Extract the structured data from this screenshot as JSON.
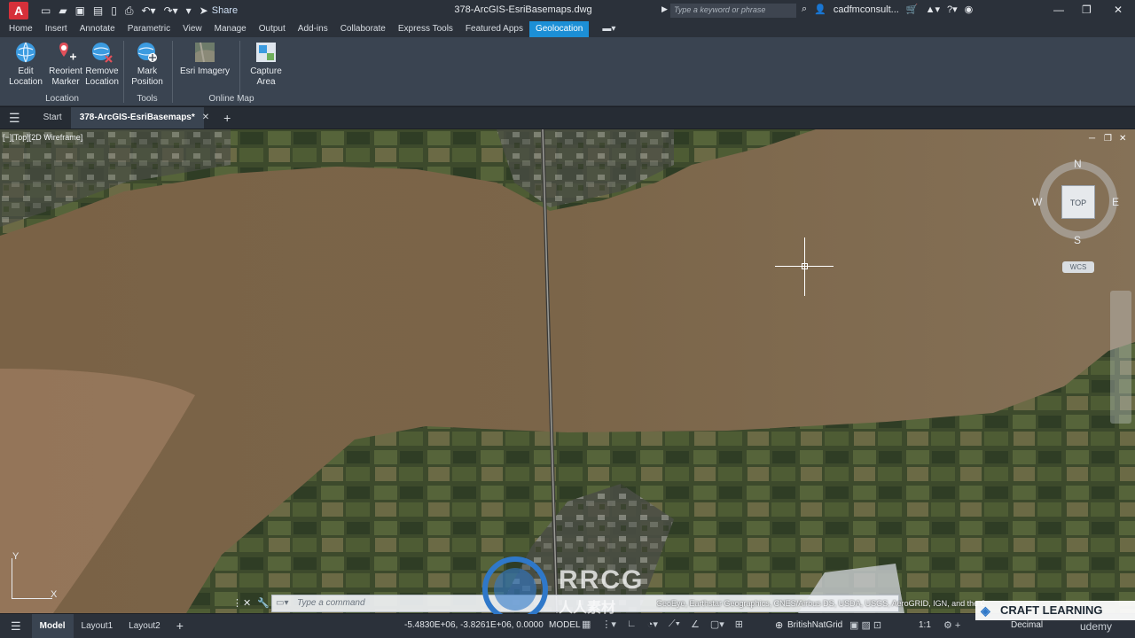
{
  "title_bar": {
    "app_letter": "A",
    "share_label": "Share",
    "document_title": "378-ArcGIS-EsriBasemaps.dwg",
    "search_placeholder": "Type a keyword or phrase",
    "user_name": "cadfmconsult..."
  },
  "ribbon": {
    "tabs": [
      "Home",
      "Insert",
      "Annotate",
      "Parametric",
      "View",
      "Manage",
      "Output",
      "Add-ins",
      "Collaborate",
      "Express Tools",
      "Featured Apps",
      "Geolocation"
    ],
    "active_tab": "Geolocation",
    "buttons": {
      "edit_location": "Edit\nLocation",
      "reorient_marker": "Reorient\nMarker",
      "remove_location": "Remove\nLocation",
      "mark_position": "Mark\nPosition",
      "esri_imagery": "Esri Imagery",
      "capture_area": "Capture\nArea"
    },
    "groups": {
      "location": "Location",
      "tools": "Tools",
      "online_map": "Online Map"
    }
  },
  "doc_tabs": {
    "start": "Start",
    "active": "378-ArcGIS-EsriBasemaps*"
  },
  "viewport": {
    "label": "[−][Top][2D Wireframe]",
    "viewcube": {
      "top": "TOP",
      "n": "N",
      "s": "S",
      "e": "E",
      "w": "W",
      "wcs": "WCS"
    },
    "ucs": {
      "x": "X",
      "y": "Y"
    }
  },
  "command_line": {
    "placeholder": "Type a command",
    "map_credits": "GeoEye, Earthstar Geographics, CNES/Airbus DS, USDA, USGS, AeroGRID, IGN, and the GIS User Community"
  },
  "status_bar": {
    "layout_tabs": [
      "Model",
      "Layout1",
      "Layout2"
    ],
    "active_layout": "Model",
    "coordinates": "-5.4830E+06, -3.8261E+06, 0.0000",
    "space": "MODEL",
    "coord_system": "BritishNatGrid",
    "scale": "1:1",
    "units": "Decimal"
  },
  "overlays": {
    "watermark_brand": "RRCG",
    "watermark_cn": "人人素材",
    "badge": "CRAFT LEARNING",
    "platform": "udemy"
  }
}
